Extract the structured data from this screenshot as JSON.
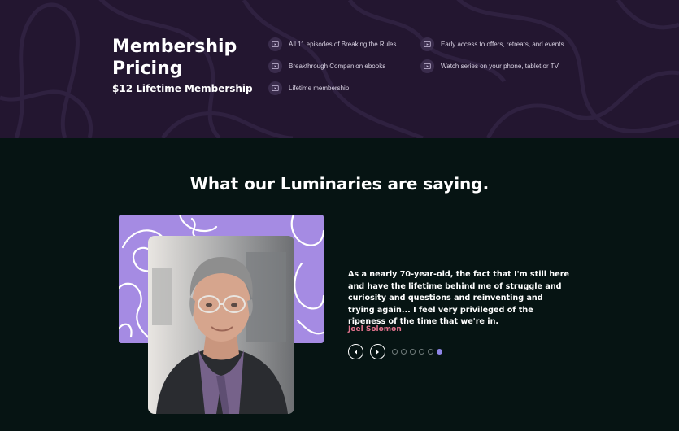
{
  "pricing": {
    "title": "Membership Pricing",
    "subtitle": "$12 Lifetime Membership",
    "features": [
      {
        "label": "All 11 episodes of Breaking the Rules",
        "icon": "play-folder-icon"
      },
      {
        "label": "Breakthrough Companion ebooks",
        "icon": "play-folder-icon"
      },
      {
        "label": "Lifetime membership",
        "icon": "play-folder-icon"
      },
      {
        "label": "Early access to offers, retreats, and events.",
        "icon": "play-folder-icon"
      },
      {
        "label": "Watch series on your phone, tablet or TV",
        "icon": "play-folder-icon"
      }
    ]
  },
  "testimonials": {
    "heading": "What our Luminaries are saying.",
    "quote": "As a nearly 70-year-old, the fact that I'm still here and have the lifetime behind me of struggle and curiosity and questions and reinventing and trying again... I feel very privileged of the ripeness of the time that we're in.",
    "author": "Joel Solomon",
    "slide_count": 6,
    "active_slide": 6
  },
  "colors": {
    "pricing_bg": "#231630",
    "section_bg": "#061413",
    "accent_purple": "#a58be3",
    "author_pink": "#e2728c",
    "active_dot": "#8f86e8"
  }
}
